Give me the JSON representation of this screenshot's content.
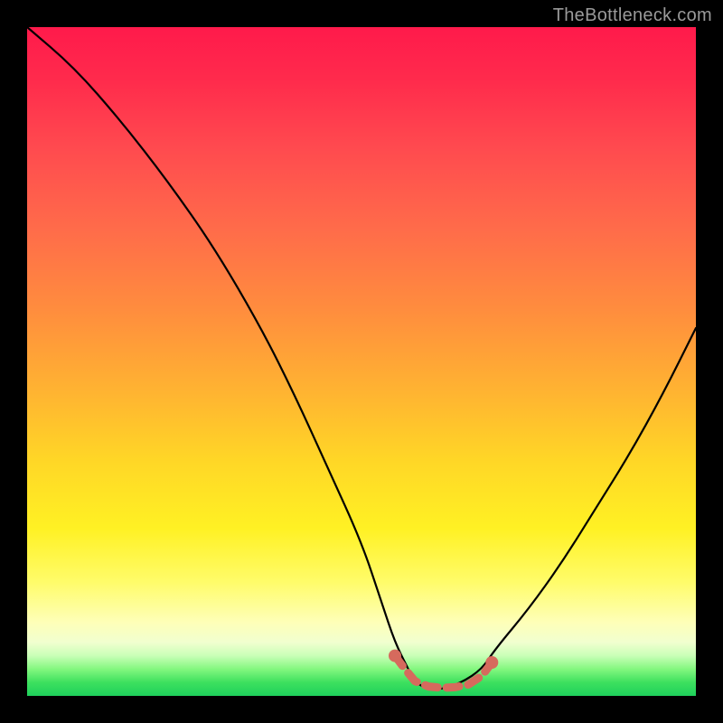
{
  "watermark": "TheBottleneck.com",
  "colors": {
    "background": "#000000",
    "curve": "#000000",
    "marker": "#d66a5d"
  },
  "chart_data": {
    "type": "line",
    "title": "",
    "xlabel": "",
    "ylabel": "",
    "xlim": [
      0,
      100
    ],
    "ylim": [
      0,
      100
    ],
    "grid": false,
    "series": [
      {
        "name": "bottleneck-curve",
        "x": [
          0,
          7,
          14,
          21,
          28,
          35,
          40,
          45,
          50,
          53,
          55,
          57,
          58,
          60,
          62,
          65,
          68,
          70,
          75,
          80,
          85,
          90,
          95,
          100
        ],
        "values": [
          100,
          94,
          86,
          77,
          67,
          55,
          45,
          34,
          23,
          14,
          8,
          4,
          2,
          1,
          1,
          2,
          4,
          7,
          13,
          20,
          28,
          36,
          45,
          55
        ]
      }
    ],
    "markers": {
      "name": "bottleneck-flat-region",
      "x": [
        55,
        56.5,
        58,
        60,
        62,
        64,
        66,
        68,
        69.5
      ],
      "values": [
        6,
        4,
        2.2,
        1.4,
        1.2,
        1.3,
        1.7,
        3,
        5
      ]
    }
  }
}
